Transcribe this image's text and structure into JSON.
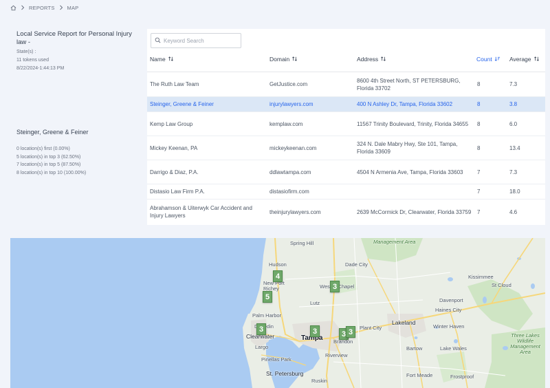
{
  "breadcrumb": {
    "home_icon": "home-icon",
    "items": [
      "REPORTS",
      "MAP"
    ]
  },
  "report": {
    "title": "Local Service Report for Personal Injury law -",
    "state": "State(s) :",
    "tokens": "11 tokens used",
    "timestamp": "8/22/2024-1:44:13 PM"
  },
  "selected": {
    "name": "Steinger, Greene & Feiner",
    "stats": [
      "0 location(s) first (0.00%)",
      "5 location(s) in top 3 (62.50%)",
      "7 location(s) in top 5 (87.50%)",
      "8 location(s) in top 10 (100.00%)"
    ]
  },
  "search": {
    "placeholder": "Keyword Search",
    "value": ""
  },
  "table": {
    "headers": {
      "name": "Name",
      "domain": "Domain",
      "address": "Address",
      "count": "Count",
      "average": "Average"
    },
    "rows": [
      {
        "name": "The Ruth Law Team",
        "domain": "GetJustice.com",
        "address": "8600 4th Street North, ST PETERSBURG, Florida 33702",
        "count": "8",
        "average": "7.3"
      },
      {
        "name": "Steinger, Greene & Feiner",
        "domain": "injurylawyers.com",
        "address": "400 N Ashley Dr, Tampa, Florida 33602",
        "count": "8",
        "average": "3.8"
      },
      {
        "name": "Kemp Law Group",
        "domain": "kemplaw.com",
        "address": "11567 Trinity Boulevard, Trinity, Florida 34655",
        "count": "8",
        "average": "6.0"
      },
      {
        "name": "Mickey Keenan, PA",
        "domain": "mickeykeenan.com",
        "address": "324 N. Dale Mabry Hwy, Ste 101, Tampa, Florida 33609",
        "count": "8",
        "average": "13.4"
      },
      {
        "name": "Darrigo & Diaz, P.A.",
        "domain": "ddlawtampa.com",
        "address": "4504 N Armenia Ave, Tampa, Florida 33603",
        "count": "7",
        "average": "7.3"
      },
      {
        "name": "Distasio Law Firm P.A.",
        "domain": "distasiofirm.com",
        "address": "",
        "count": "7",
        "average": "18.0"
      },
      {
        "name": "Abrahamson & Uiterwyk Car Accident and Injury Lawyers",
        "domain": "theinjurylawyers.com",
        "address": "2639 McCormick Dr, Clearwater, Florida 33759",
        "count": "7",
        "average": "4.6"
      }
    ]
  },
  "map": {
    "labels": {
      "spring_hill": "Spring Hill",
      "hudson": "Hudson",
      "new_port_richey": "New Port Richey",
      "dade_city": "Dade City",
      "wesley_chapel": "Wesley Chapel",
      "lutz": "Lutz",
      "palm_harbor": "Palm Harbor",
      "dunedin": "Dunedin",
      "clearwater": "Clearwater",
      "tampa": "Tampa",
      "brandon": "Brandon",
      "plant_city": "Plant City",
      "lakeland": "Lakeland",
      "winter_haven": "Winter Haven",
      "haines_city": "Haines City",
      "davenport": "Davenport",
      "kissimmee": "Kissimmee",
      "st_cloud": "St Cloud",
      "largo": "Largo",
      "pinellas_park": "Pinellas Park",
      "st_petersburg": "St. Petersburg",
      "riverview": "Riverview",
      "ruskin": "Ruskin",
      "bartow": "Bartow",
      "lake_wales": "Lake Wales",
      "fort_meade": "Fort Meade",
      "frostproof": "Frostproof",
      "three_lakes": "Three Lakes Wildlife Management Area",
      "management_area": "Management Area"
    },
    "markers": [
      "4",
      "5",
      "3",
      "3",
      "3",
      "3",
      "3"
    ]
  }
}
